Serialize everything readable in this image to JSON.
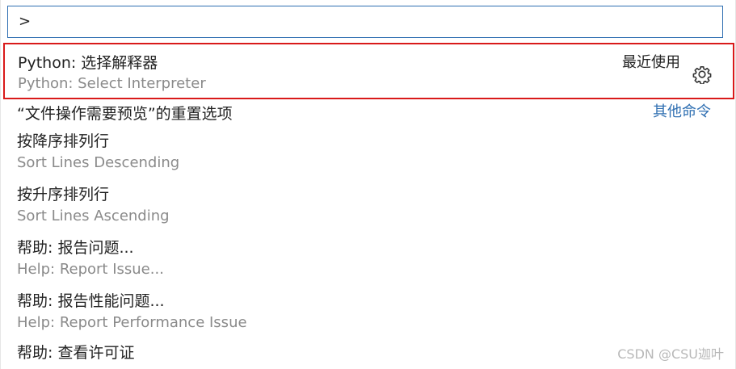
{
  "quick_open": {
    "query": ">",
    "items": [
      {
        "label": "Python: 选择解释器",
        "detail": "Python: Select Interpreter",
        "right_label": "最近使用",
        "icon": "gear-icon"
      },
      {
        "label": "“文件操作需要预览”的重置选项",
        "right_label": "其他命令"
      },
      {
        "label": "按降序排列行",
        "detail": "Sort Lines Descending"
      },
      {
        "label": "按升序排列行",
        "detail": "Sort Lines Ascending"
      },
      {
        "label": "帮助: 报告问题...",
        "detail": "Help: Report Issue..."
      },
      {
        "label": "帮助: 报告性能问题...",
        "detail": "Help: Report Performance Issue"
      },
      {
        "label": "帮助: 查看许可证"
      }
    ]
  },
  "watermark": "CSDN @CSU迦叶",
  "colors": {
    "selection_border": "#d91a1a",
    "focus_border": "#2f6fb2",
    "link": "#2f6fb2"
  }
}
